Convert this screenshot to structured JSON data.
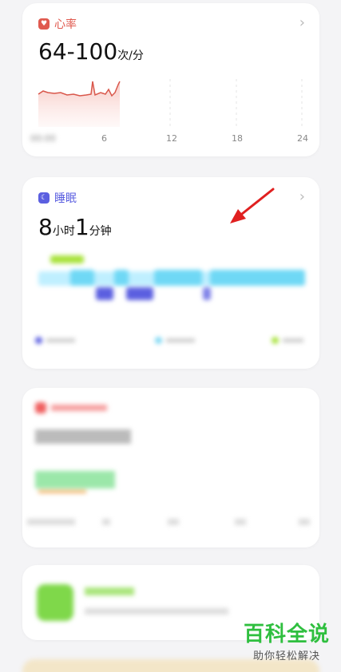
{
  "heart_card": {
    "title": "心率",
    "value": "64-100",
    "unit": "次/分",
    "x_ticks": [
      "6",
      "12",
      "18",
      "24"
    ],
    "accent": "#e05a4f"
  },
  "sleep_card": {
    "title": "睡眠",
    "hours": "8",
    "hours_unit": "小时",
    "minutes": "1",
    "minutes_unit": "分钟",
    "accent": "#5b5fe0"
  },
  "watermark": {
    "main": "百科全说",
    "sub": "助你轻松解决"
  }
}
